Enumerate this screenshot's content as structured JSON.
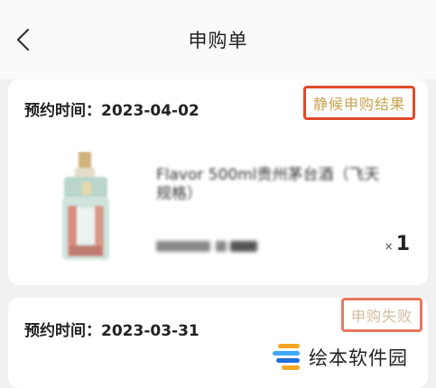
{
  "header": {
    "title": "申购单",
    "back_icon": "chevron-left-icon"
  },
  "orders": [
    {
      "date_label": "预约时间：2023-04-02",
      "status": "静候申购结果",
      "status_color": "#c8a24f",
      "product_name": "Flavor 500ml贵州茅台酒（飞天规格）",
      "quantity_prefix": "×",
      "quantity": "1"
    },
    {
      "date_label": "预约时间：2023-03-31",
      "status": "申购失败",
      "status_color": "#c8a77f"
    }
  ],
  "colors": {
    "highlight_border": "#e04a2a",
    "page_bg": "#f1f1f1",
    "card_bg": "#ffffff"
  },
  "watermark": {
    "text": "绘本软件园",
    "icon": "watermark-logo-icon"
  }
}
